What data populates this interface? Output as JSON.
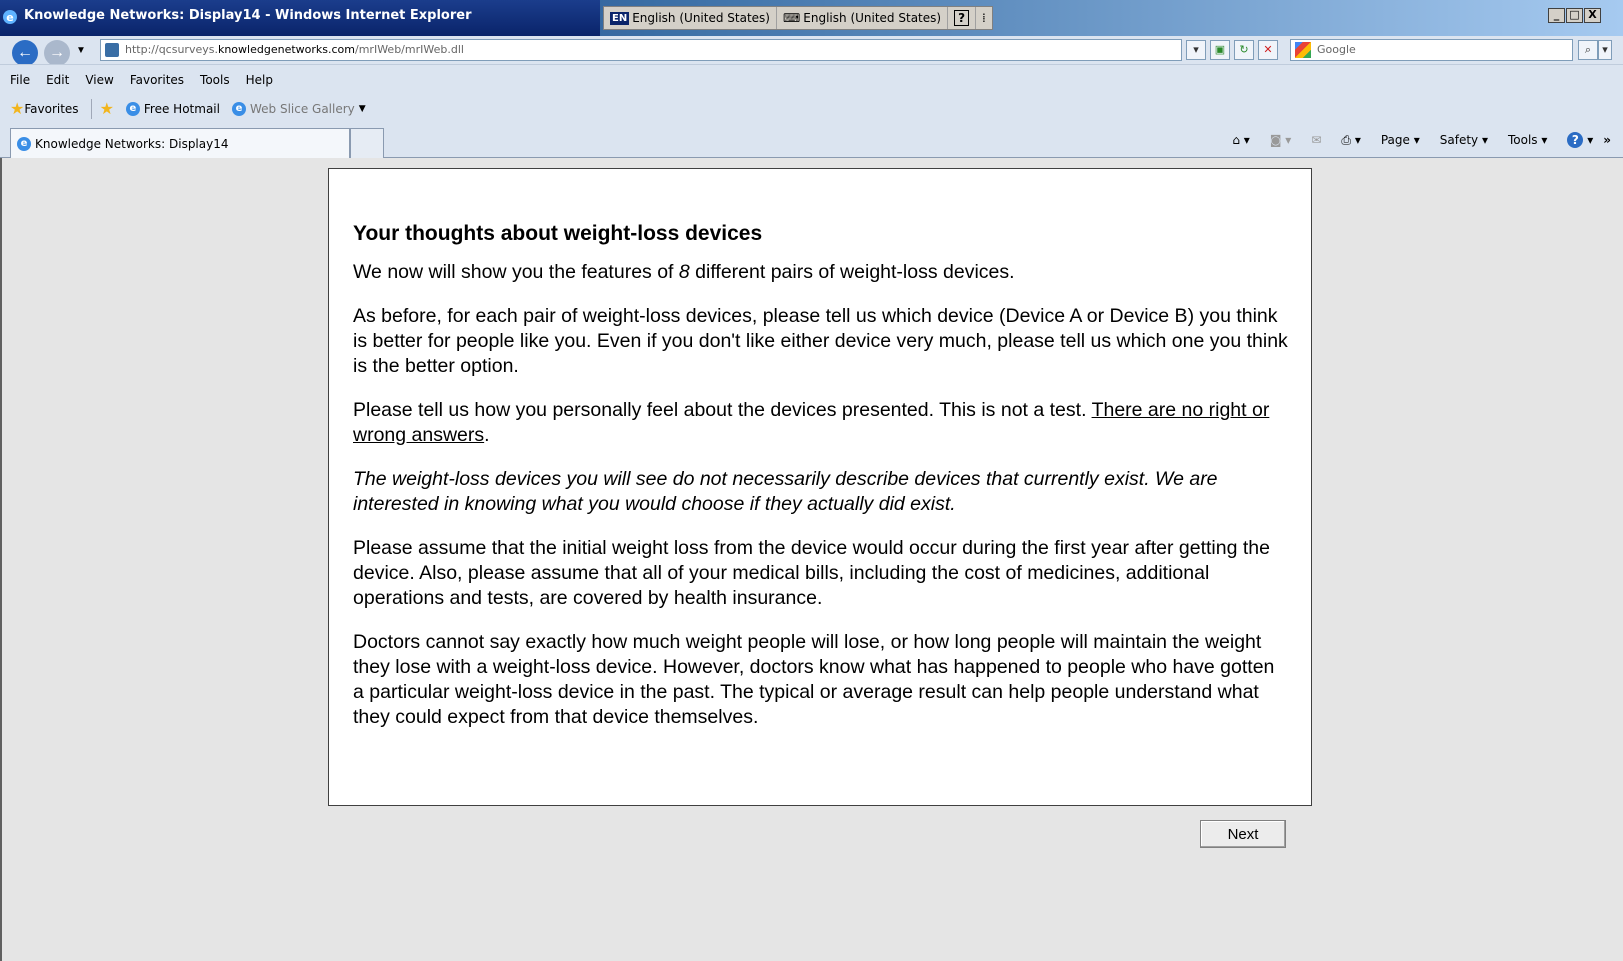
{
  "window": {
    "title": "Knowledge Networks: Display14 - Windows Internet Explorer",
    "lang_code": "EN",
    "lang_1": "English (United States)",
    "lang_2": "English (United States)",
    "minimize": "_",
    "maximize": "□",
    "close": "X"
  },
  "address": {
    "url_prefix": "http://qcsurveys.",
    "url_host": "knowledgenetworks.com",
    "url_path": "/mrIWeb/mrIWeb.dll",
    "search_placeholder": "Google"
  },
  "menu": [
    "File",
    "Edit",
    "View",
    "Favorites",
    "Tools",
    "Help"
  ],
  "favorites": {
    "favorites_label": "Favorites",
    "hotmail_label": "Free Hotmail",
    "webslice_label": "Web Slice Gallery"
  },
  "tab": {
    "label": "Knowledge Networks: Display14"
  },
  "commands": {
    "page": "Page",
    "safety": "Safety",
    "tools": "Tools"
  },
  "survey": {
    "heading": "Your thoughts about weight-loss devices",
    "p1_before": "We now will show you the features of ",
    "p1_num": "8",
    "p1_after": " different pairs of weight-loss devices.",
    "p2": "As before, for each pair of weight-loss devices, please tell us which device (Device A or Device B) you think is better for people like you. Even if you don't like either device very much, please tell us which one you think is the better option.",
    "p3_before": "Please tell us how you personally feel about the devices presented. This is not a test. ",
    "p3_underline": "There are no right or wrong answers",
    "p3_after": ".",
    "p4": "The weight-loss devices you will see do not necessarily describe devices that currently exist. We are interested in knowing what you would choose if they actually did exist.",
    "p5": "Please assume that the initial weight loss from the device would occur during the first year after getting the device. Also, please assume that all of your medical bills, including the cost of medicines, additional operations and tests, are covered by health insurance.",
    "p6": "Doctors cannot say exactly how much weight people will lose, or how long people will maintain the weight they lose with a weight-loss device. However, doctors know what has happened to people who have gotten a particular weight-loss device in the past. The typical or average result can help people understand what they could expect from that device themselves.",
    "next_label": "Next"
  }
}
